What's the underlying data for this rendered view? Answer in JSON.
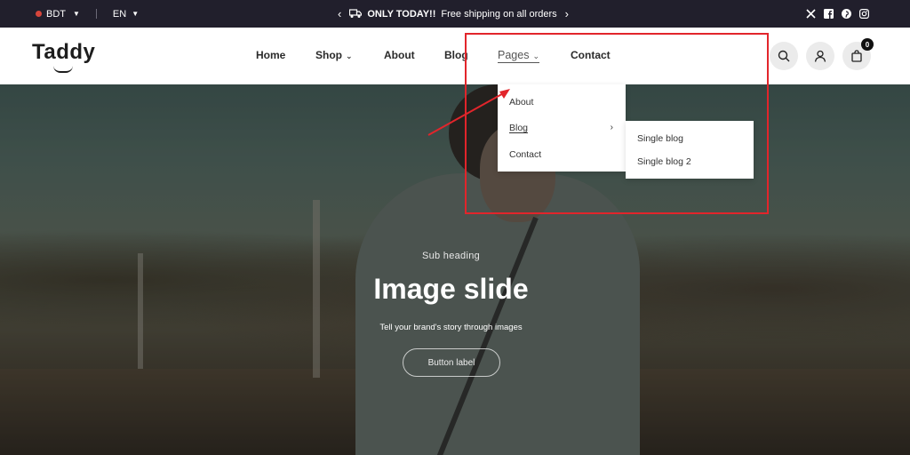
{
  "topbar": {
    "currency": "BDT",
    "language": "EN",
    "announcement_bold": "ONLY TODAY!!",
    "announcement_text": "Free shipping on all orders",
    "prev_arrow": "‹",
    "next_arrow": "›",
    "social_icons": [
      "x-icon",
      "facebook-icon",
      "pinterest-icon",
      "instagram-icon"
    ]
  },
  "header": {
    "logo": "Taddy",
    "nav": {
      "home": "Home",
      "shop": "Shop",
      "about": "About",
      "blog": "Blog",
      "pages": "Pages",
      "contact": "Contact"
    },
    "cart_count": "0"
  },
  "pages_dropdown": {
    "items": [
      "About",
      "Blog",
      "Contact"
    ],
    "blog_submenu": [
      "Single blog",
      "Single blog 2"
    ]
  },
  "hero": {
    "sub_heading": "Sub heading",
    "title": "Image slide",
    "text": "Tell your brand's story through images",
    "button_label": "Button label"
  },
  "colors": {
    "topbar_bg": "#211f2c",
    "highlight": "#e2252b",
    "accent_dark": "#111111"
  }
}
